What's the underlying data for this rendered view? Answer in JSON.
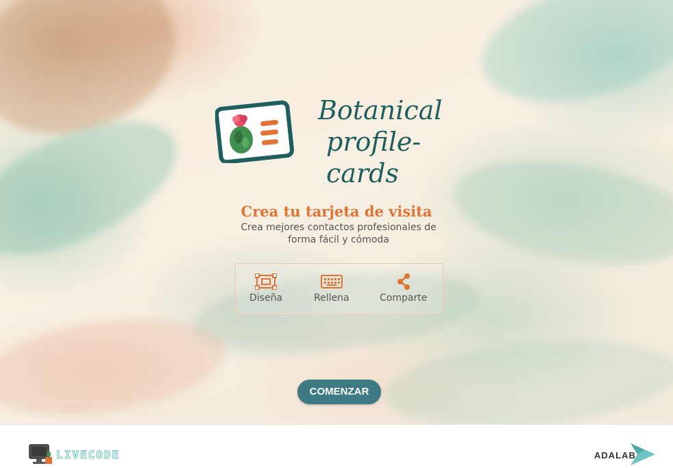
{
  "brand": {
    "title_line1": "Botanical",
    "title_line2": "profile-cards"
  },
  "hero": {
    "headline": "Crea tu tarjeta de visita",
    "subtitle": "Crea mejores contactos profesionales de forma fácil y cómoda"
  },
  "steps": [
    {
      "label": "Diseña",
      "icon": "design-icon"
    },
    {
      "label": "Rellena",
      "icon": "keyboard-icon"
    },
    {
      "label": "Comparte",
      "icon": "share-icon"
    }
  ],
  "cta": {
    "label": "COMENZAR"
  },
  "footer": {
    "left_brand": "LIVECODE",
    "right_brand": "ADALAB"
  },
  "colors": {
    "accent_orange": "#e17334",
    "teal_dark": "#1f5e5e",
    "button_teal": "#3d7a84",
    "text_gray": "#555555"
  }
}
